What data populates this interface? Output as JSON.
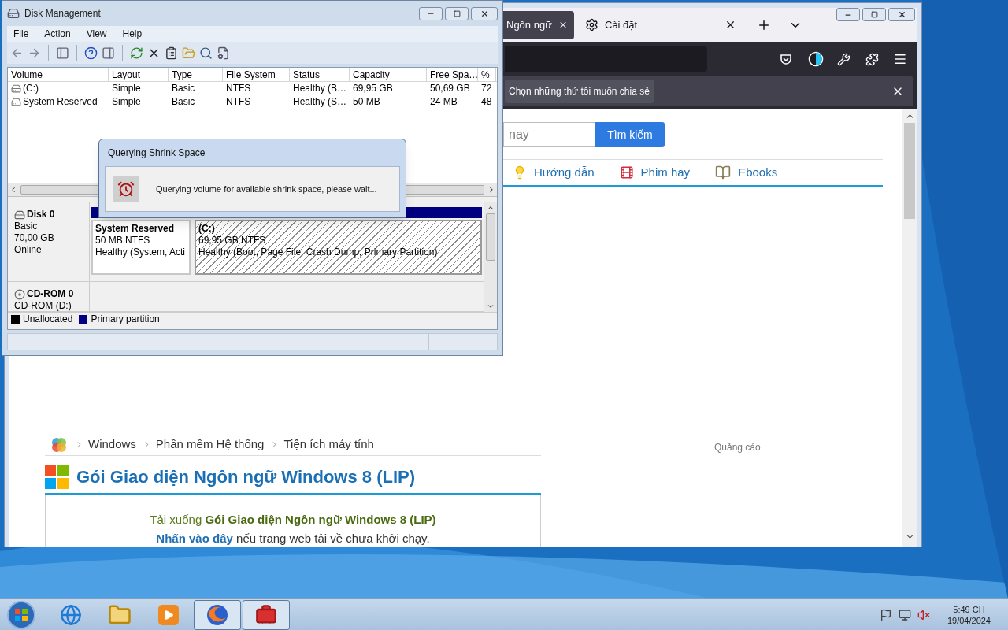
{
  "disk_management": {
    "title": "Disk Management",
    "menu": [
      "File",
      "Action",
      "View",
      "Help"
    ],
    "columns": [
      "Volume",
      "Layout",
      "Type",
      "File System",
      "Status",
      "Capacity",
      "Free Spa…",
      "%"
    ],
    "volumes": [
      {
        "cells": [
          "(C:)",
          "Simple",
          "Basic",
          "NTFS",
          "Healthy (B…",
          "69,95 GB",
          "50,69 GB",
          "72"
        ]
      },
      {
        "cells": [
          "System Reserved",
          "Simple",
          "Basic",
          "NTFS",
          "Healthy (S…",
          "50 MB",
          "24 MB",
          "48"
        ]
      }
    ],
    "disks": [
      {
        "kind": "disk",
        "name": "Disk 0",
        "lines": [
          "Basic",
          "70,00 GB",
          "Online"
        ],
        "partitions": [
          {
            "name": "System Reserved",
            "size": "50 MB NTFS",
            "status": "Healthy (System, Acti",
            "selected": false
          },
          {
            "name": "(C:)",
            "size": "69,95 GB NTFS",
            "status": "Healthy (Boot, Page File, Crash Dump, Primary Partition)",
            "selected": true
          }
        ]
      },
      {
        "kind": "cdrom",
        "name": "CD-ROM 0",
        "lines": [
          "CD-ROM (D:)"
        ]
      }
    ],
    "legend": [
      {
        "label": "Unallocated",
        "color": "#000000"
      },
      {
        "label": "Primary partition",
        "color": "#000080"
      }
    ],
    "dialog": {
      "title": "Querying Shrink Space",
      "message": "Querying volume for available shrink space, please wait..."
    }
  },
  "browser": {
    "tabs": [
      {
        "label": "Ngôn ngữ",
        "selected": true
      },
      {
        "label": "Cài đặt",
        "selected": false
      }
    ],
    "notification": "Chọn những thứ tôi muốn chia sẻ",
    "search": {
      "placeholder": "nay",
      "button": "Tìm kiếm"
    },
    "nav": [
      {
        "kind": "guide",
        "label": "Hướng dẫn"
      },
      {
        "kind": "movie",
        "label": "Phim hay"
      },
      {
        "kind": "book",
        "label": "Ebooks"
      }
    ],
    "breadcrumb": [
      "Windows",
      "Phần mềm Hệ thống",
      "Tiện ích máy tính"
    ],
    "title": "Gói Giao diện Ngôn ngữ Windows 8 (LIP)",
    "download_line": "Tải xuống **Gói Giao diện Ngôn ngữ Windows 8 (LIP)**",
    "hint_link": "Nhấn vào đây",
    "hint_rest": " nếu trang web tải về chưa khởi chạy.",
    "ad_label": "Quảng cáo"
  },
  "taskbar": {
    "apps": [
      {
        "kind": "ie",
        "open": false
      },
      {
        "kind": "folder",
        "open": false
      },
      {
        "kind": "media",
        "open": false
      },
      {
        "kind": "firefox",
        "open": true
      },
      {
        "kind": "toolbox",
        "open": true
      }
    ],
    "time": "5:49 CH",
    "date": "19/04/2024"
  }
}
